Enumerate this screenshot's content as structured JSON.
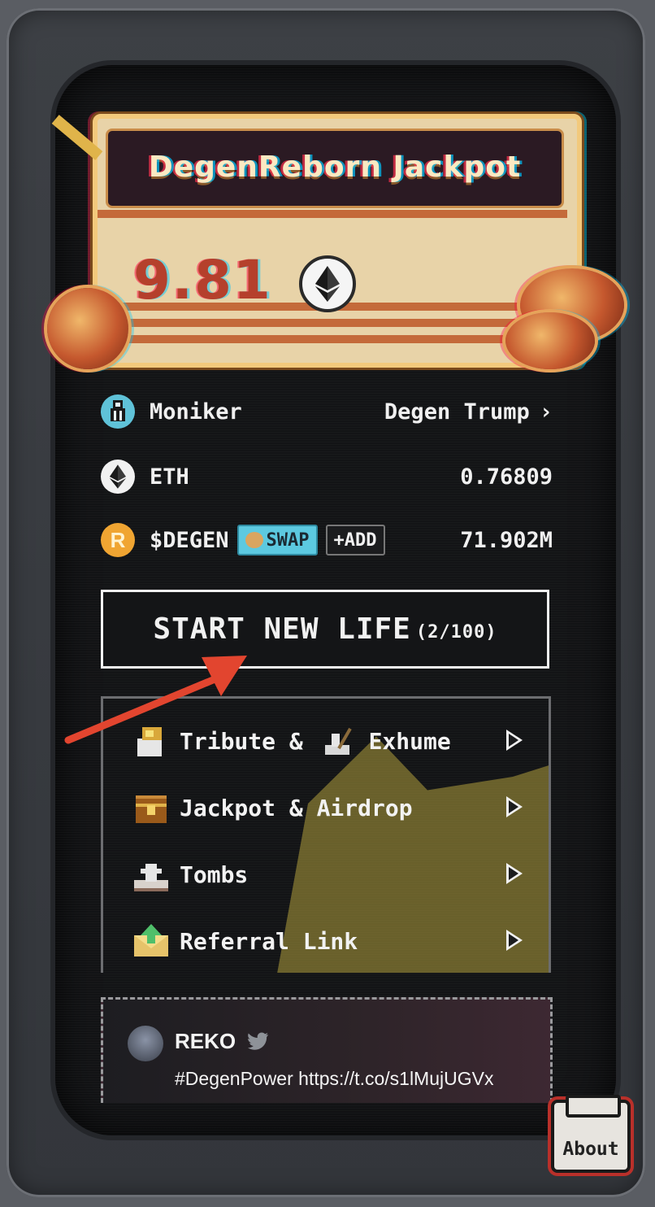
{
  "jackpot": {
    "title": "DegenReborn Jackpot",
    "amount": "9.81",
    "currency_icon": "eth-icon"
  },
  "balances": {
    "moniker": {
      "label": "Moniker",
      "value": "Degen Trump",
      "chevron": "›"
    },
    "eth": {
      "label": "ETH",
      "value": "0.76809"
    },
    "degen": {
      "label": "$DEGEN",
      "swap_label": "SWAP",
      "add_label": "+ADD",
      "value": "71.902M"
    }
  },
  "start": {
    "label": "START NEW LIFE",
    "count": "(2/100)"
  },
  "menu": {
    "items": [
      {
        "label_a": "Tribute & ",
        "label_b": "Exhume"
      },
      {
        "label_a": "Jackpot & Airdrop",
        "label_b": ""
      },
      {
        "label_a": "Tombs",
        "label_b": ""
      },
      {
        "label_a": "Referral Link",
        "label_b": ""
      }
    ]
  },
  "tweet": {
    "author": "REKO",
    "text": "#DegenPower https://t.co/s1lMujUGVx"
  },
  "about": {
    "label": "About"
  },
  "colors": {
    "accent_red": "#e2452f",
    "jackpot_text": "#b5402c",
    "swap_bg": "#5cc9e0",
    "screen_bg": "#131416"
  }
}
